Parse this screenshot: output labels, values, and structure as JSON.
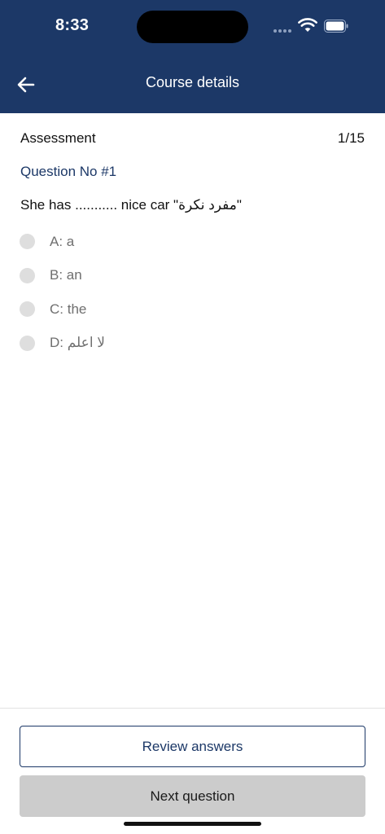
{
  "status_bar": {
    "time": "8:33",
    "icons": [
      "signal-icon",
      "wifi-icon",
      "battery-icon"
    ]
  },
  "header": {
    "back_icon": "arrow-left-icon",
    "title": "Course details"
  },
  "assessment": {
    "title": "Assessment",
    "counter": "1/15"
  },
  "question": {
    "number": "Question No #1",
    "text": "She has ........... nice car \"مفرد نكرة\"",
    "options": [
      {
        "label": "A: a",
        "selected": false
      },
      {
        "label": "B: an",
        "selected": false
      },
      {
        "label": "C: the",
        "selected": false
      },
      {
        "label": "D: لا اعلم",
        "selected": false
      }
    ]
  },
  "actions": {
    "review_label": "Review answers",
    "next_label": "Next question"
  },
  "colors": {
    "header_bg": "#1c3867",
    "accent": "#1c3867",
    "radio_bg": "#dedede",
    "next_button_bg": "#cccccc"
  }
}
